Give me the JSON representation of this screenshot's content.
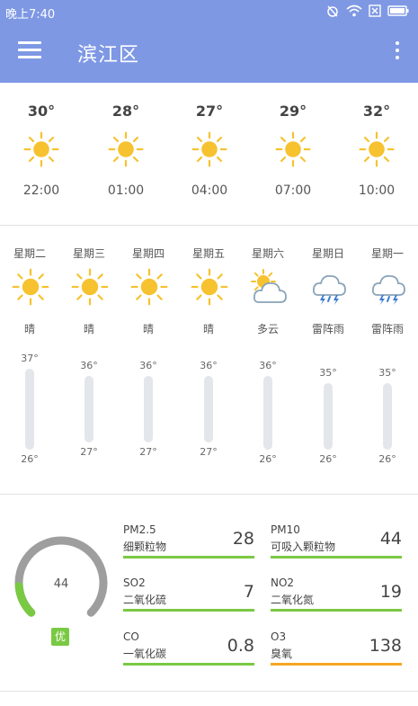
{
  "status": {
    "time": "晚上7:40"
  },
  "app": {
    "title": "滨江区"
  },
  "hourly": [
    {
      "temp": "30°",
      "time": "22:00",
      "icon": "sun-icon"
    },
    {
      "temp": "28°",
      "time": "01:00",
      "icon": "sun-icon"
    },
    {
      "temp": "27°",
      "time": "04:00",
      "icon": "sun-icon"
    },
    {
      "temp": "29°",
      "time": "07:00",
      "icon": "sun-icon"
    },
    {
      "temp": "32°",
      "time": "10:00",
      "icon": "sun-icon"
    }
  ],
  "daily": [
    {
      "day": "星期二",
      "desc": "晴",
      "high": "37°",
      "low": "26°",
      "high_val": 37,
      "low_val": 26,
      "icon": "sun-icon"
    },
    {
      "day": "星期三",
      "desc": "晴",
      "high": "36°",
      "low": "27°",
      "high_val": 36,
      "low_val": 27,
      "icon": "sun-icon"
    },
    {
      "day": "星期四",
      "desc": "晴",
      "high": "36°",
      "low": "27°",
      "high_val": 36,
      "low_val": 27,
      "icon": "sun-icon"
    },
    {
      "day": "星期五",
      "desc": "晴",
      "high": "36°",
      "low": "27°",
      "high_val": 36,
      "low_val": 27,
      "icon": "sun-icon"
    },
    {
      "day": "星期六",
      "desc": "多云",
      "high": "36°",
      "low": "26°",
      "high_val": 36,
      "low_val": 26,
      "icon": "partly-cloudy-icon"
    },
    {
      "day": "星期日",
      "desc": "雷阵雨",
      "high": "35°",
      "low": "26°",
      "high_val": 35,
      "low_val": 26,
      "icon": "thunderstorm-icon"
    },
    {
      "day": "星期一",
      "desc": "雷阵雨",
      "high": "35°",
      "low": "26°",
      "high_val": 35,
      "low_val": 26,
      "icon": "thunderstorm-icon"
    }
  ],
  "air": {
    "aqi": "44",
    "aqi_fraction": 0.15,
    "level": "优",
    "pollutants": [
      {
        "code": "PM2.5",
        "name": "细颗粒物",
        "value": "28",
        "color": "#7ac943"
      },
      {
        "code": "PM10",
        "name": "可吸入颗粒物",
        "value": "44",
        "color": "#7ac943"
      },
      {
        "code": "SO2",
        "name": "二氧化硫",
        "value": "7",
        "color": "#7ac943"
      },
      {
        "code": "NO2",
        "name": "二氧化氮",
        "value": "19",
        "color": "#7ac943"
      },
      {
        "code": "CO",
        "name": "一氧化碳",
        "value": "0.8",
        "color": "#7ac943"
      },
      {
        "code": "O3",
        "name": "臭氧",
        "value": "138",
        "color": "#f5a623"
      }
    ]
  },
  "colors": {
    "accent": "#7e98e4",
    "sun": "#f6c230",
    "good": "#7ac943",
    "moderate": "#f5a623",
    "gauge_track": "#9e9e9e"
  }
}
